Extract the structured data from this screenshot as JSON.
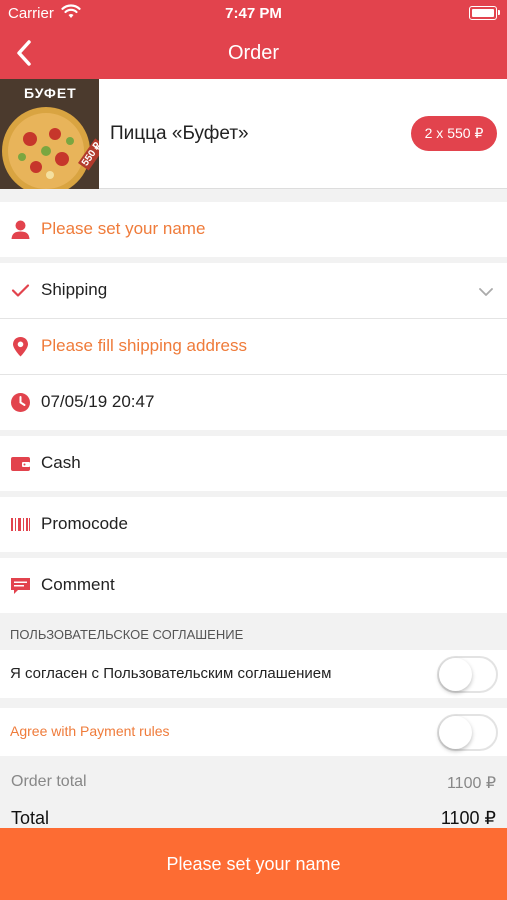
{
  "status_bar": {
    "carrier": "Carrier",
    "time": "7:47 PM"
  },
  "nav": {
    "title": "Order"
  },
  "product": {
    "name": "Пицца «Буфет»",
    "quantity_price": "2 x 550 ₽",
    "thumb_text": "БУФЕТ",
    "thumb_price": "550 ₽"
  },
  "form": {
    "name_prompt": "Please set your name",
    "delivery_method": "Shipping",
    "address_prompt": "Please fill shipping address",
    "datetime": "07/05/19 20:47",
    "payment": "Cash",
    "promocode": "Promocode",
    "comment": "Comment"
  },
  "agreement": {
    "section_title": "ПОЛЬЗОВАТЕЛЬСКОЕ СОГЛАШЕНИЕ",
    "user_agreement_label": "Я согласен с Пользовательским соглашением",
    "user_agreement_on": false,
    "payment_rules_label": "Agree with Payment rules",
    "payment_rules_on": false
  },
  "totals": {
    "order_total_label": "Order total",
    "order_total_value": "1100 ₽",
    "total_label": "Total",
    "total_value": "1100 ₽"
  },
  "submit": {
    "label": "Please set your name"
  },
  "colors": {
    "brand_red": "#e2434d",
    "warn_orange": "#ef7b3a",
    "submit_orange": "#fd6c33"
  }
}
